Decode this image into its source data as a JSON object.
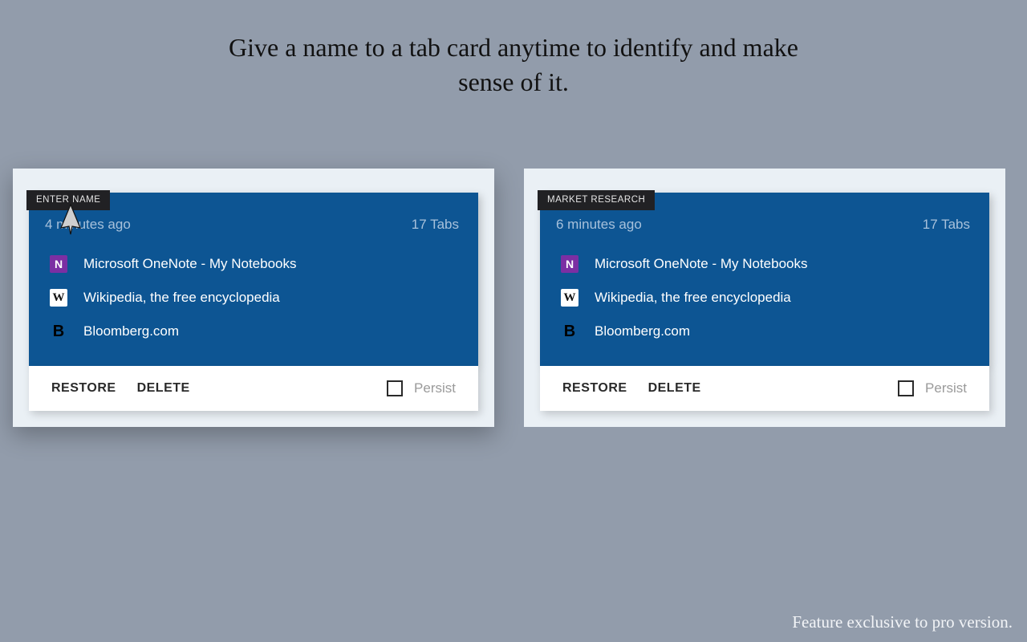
{
  "headline": "Give a name to a tab card anytime to identify and make sense of it.",
  "cards": [
    {
      "label": "ENTER NAME",
      "timestamp": "4 minutes ago",
      "tabCount": "17 Tabs",
      "items": [
        {
          "title": "Microsoft OneNote - My Notebooks",
          "iconText": "N",
          "iconClass": "fav-onenote"
        },
        {
          "title": "Wikipedia, the free encyclopedia",
          "iconText": "W",
          "iconClass": "fav-wiki"
        },
        {
          "title": "Bloomberg.com",
          "iconText": "B",
          "iconClass": "fav-bloomberg"
        }
      ],
      "restore": "RESTORE",
      "delete": "DELETE",
      "persist": "Persist"
    },
    {
      "label": "MARKET RESEARCH",
      "timestamp": "6 minutes ago",
      "tabCount": "17 Tabs",
      "items": [
        {
          "title": "Microsoft OneNote - My Notebooks",
          "iconText": "N",
          "iconClass": "fav-onenote"
        },
        {
          "title": "Wikipedia, the free encyclopedia",
          "iconText": "W",
          "iconClass": "fav-wiki"
        },
        {
          "title": "Bloomberg.com",
          "iconText": "B",
          "iconClass": "fav-bloomberg"
        }
      ],
      "restore": "RESTORE",
      "delete": "DELETE",
      "persist": "Persist"
    }
  ],
  "footnote": "Feature exclusive to pro version."
}
